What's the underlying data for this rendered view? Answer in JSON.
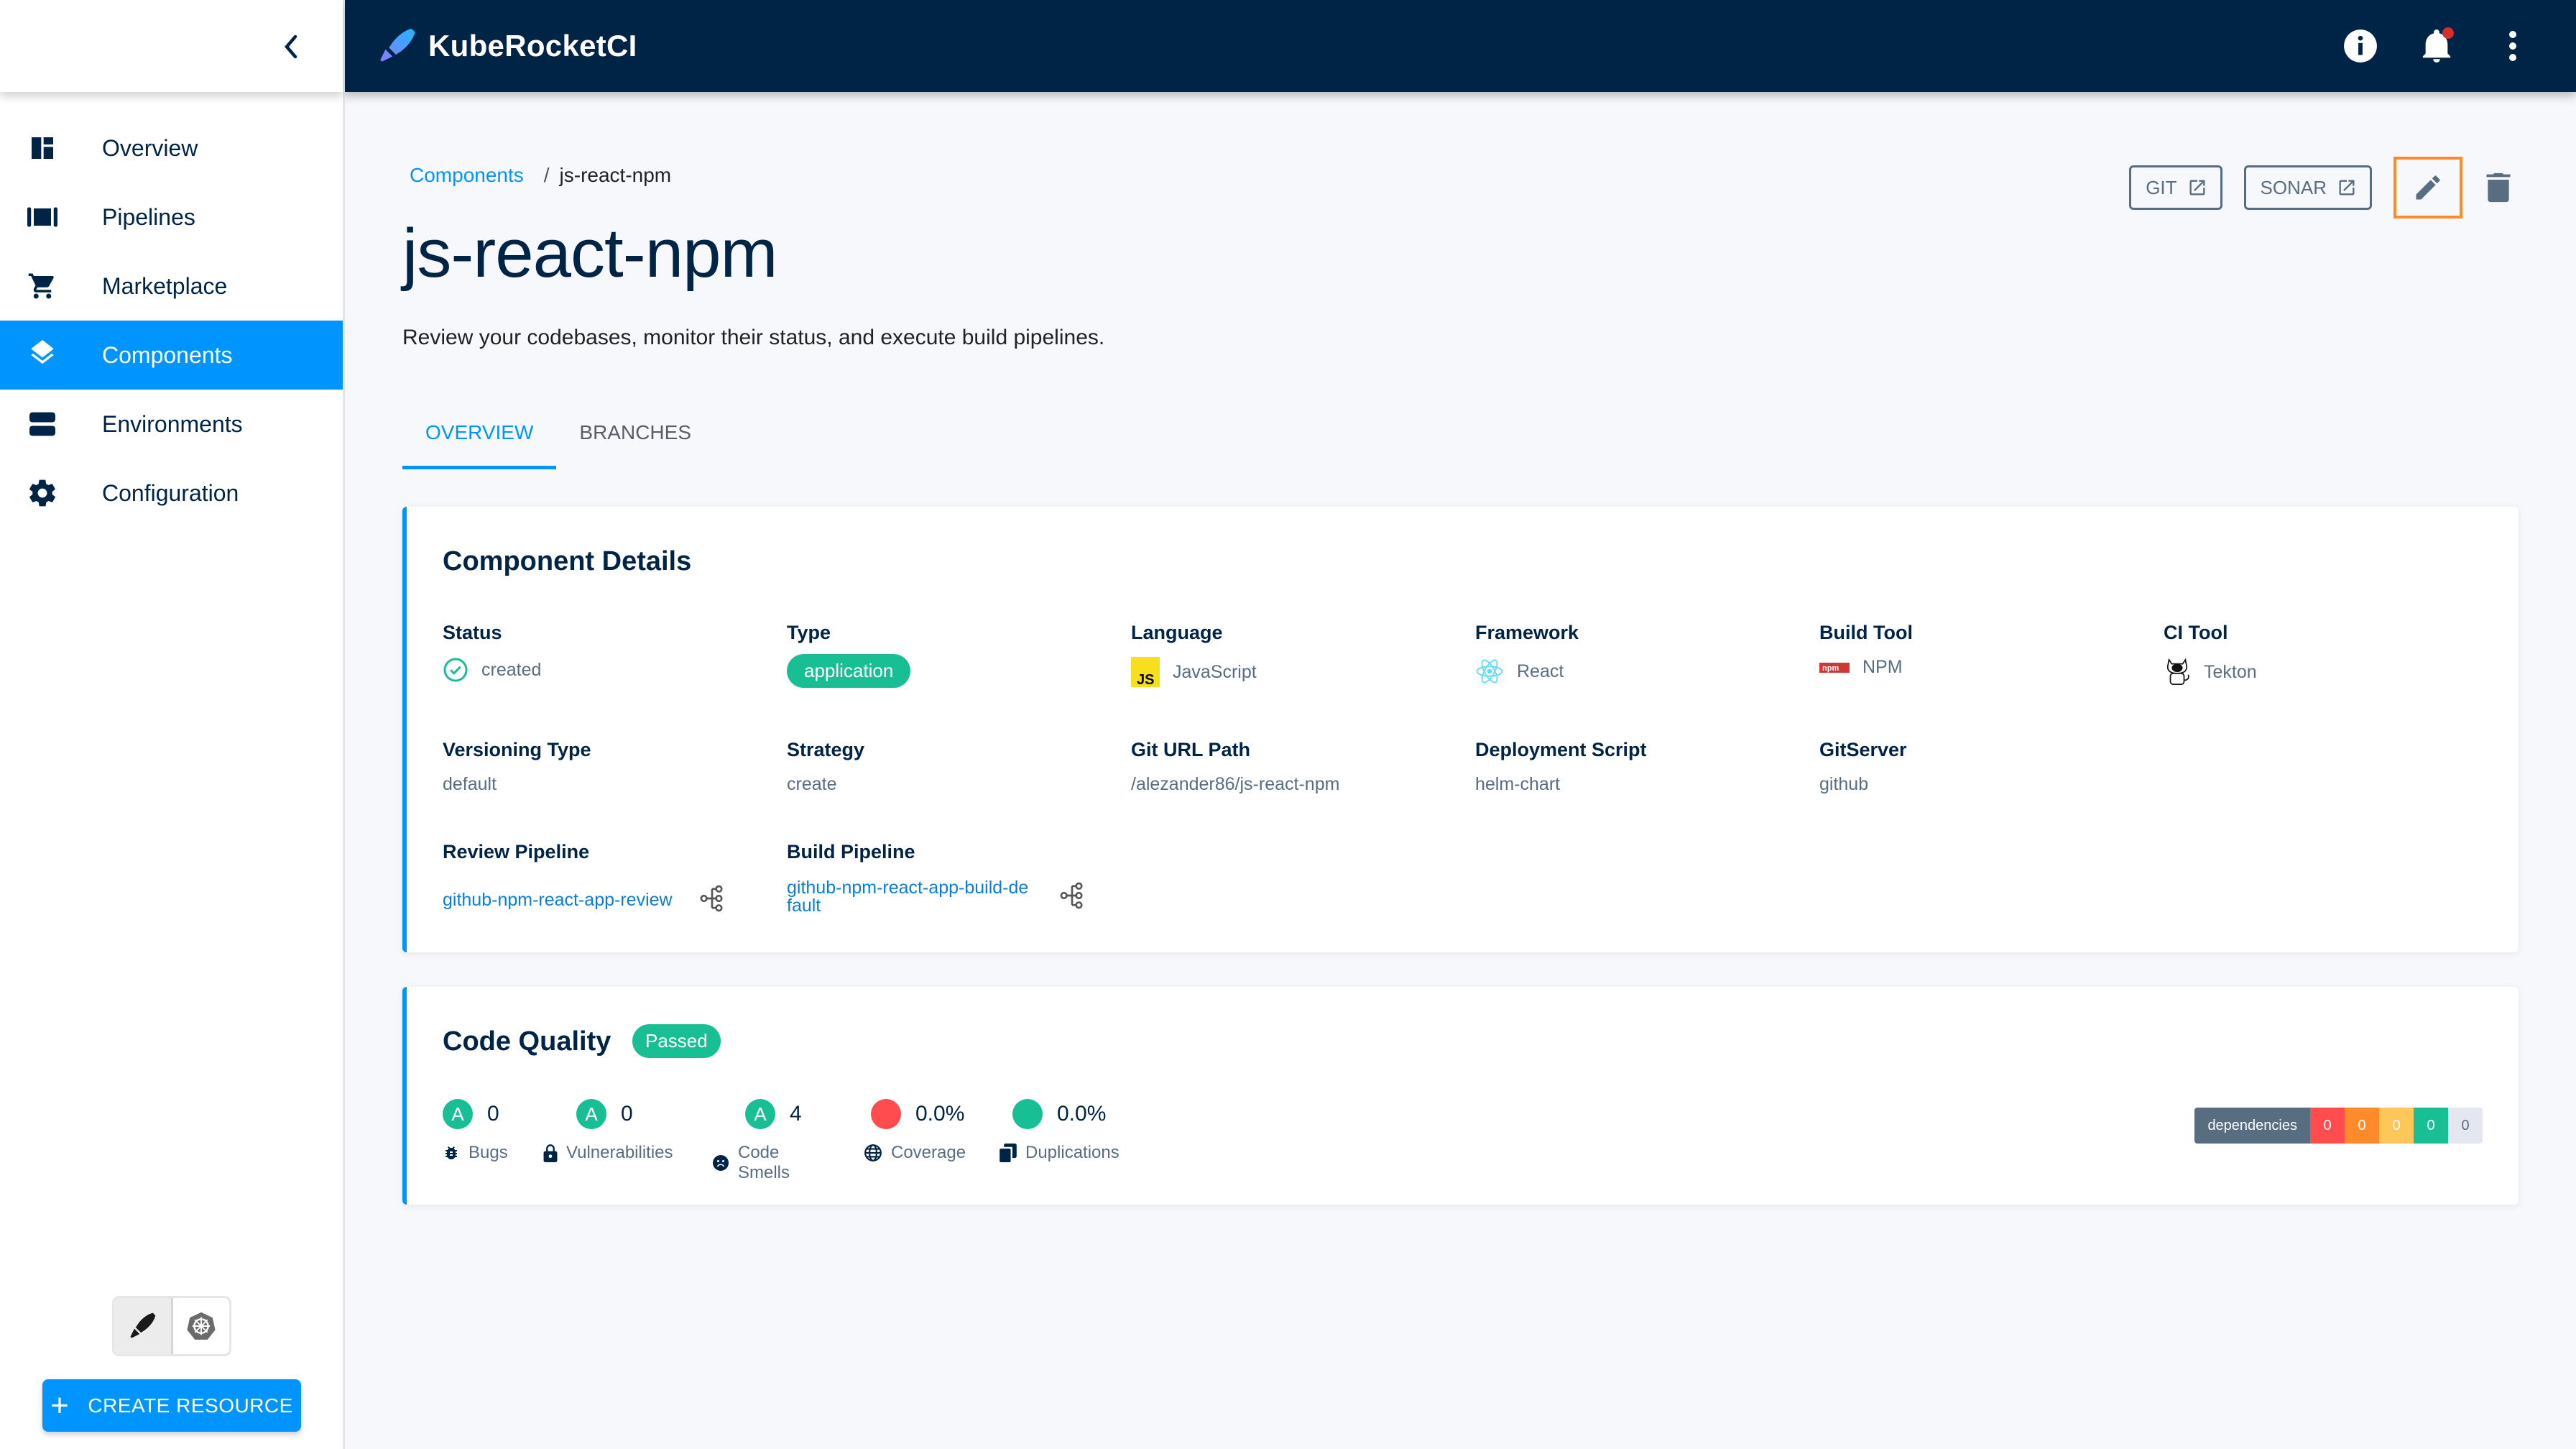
{
  "app": {
    "title": "KubeRocketCI",
    "notification_dot": true
  },
  "sidebar": {
    "items": [
      {
        "label": "Overview",
        "icon": "dashboard-icon",
        "active": false
      },
      {
        "label": "Pipelines",
        "icon": "pipelines-icon",
        "active": false
      },
      {
        "label": "Marketplace",
        "icon": "cart-icon",
        "active": false
      },
      {
        "label": "Components",
        "icon": "layers-icon",
        "active": true
      },
      {
        "label": "Environments",
        "icon": "environments-icon",
        "active": false
      },
      {
        "label": "Configuration",
        "icon": "gear-icon",
        "active": false
      }
    ],
    "create_button": "CREATE RESOURCE"
  },
  "breadcrumb": {
    "parent": "Components",
    "separator": "/",
    "current": "js-react-npm"
  },
  "page": {
    "title": "js-react-npm",
    "description": "Review your codebases, monitor their status, and execute build pipelines."
  },
  "header_actions": {
    "git_label": "GIT",
    "sonar_label": "SONAR"
  },
  "tabs": [
    {
      "label": "OVERVIEW",
      "active": true
    },
    {
      "label": "BRANCHES",
      "active": false
    }
  ],
  "details": {
    "title": "Component Details",
    "status": {
      "label": "Status",
      "value": "created"
    },
    "type": {
      "label": "Type",
      "value": "application"
    },
    "language": {
      "label": "Language",
      "value": "JavaScript"
    },
    "framework": {
      "label": "Framework",
      "value": "React"
    },
    "build_tool": {
      "label": "Build Tool",
      "value": "NPM"
    },
    "ci_tool": {
      "label": "CI Tool",
      "value": "Tekton"
    },
    "versioning_type": {
      "label": "Versioning Type",
      "value": "default"
    },
    "strategy": {
      "label": "Strategy",
      "value": "create"
    },
    "git_url_path": {
      "label": "Git URL Path",
      "value": "/alezander86/js-react-npm"
    },
    "deployment_script": {
      "label": "Deployment Script",
      "value": "helm-chart"
    },
    "git_server": {
      "label": "GitServer",
      "value": "github"
    },
    "review_pipeline": {
      "label": "Review Pipeline",
      "value": "github-npm-react-app-review"
    },
    "build_pipeline": {
      "label": "Build Pipeline",
      "value": "github-npm-react-app-build-default"
    }
  },
  "quality": {
    "title": "Code Quality",
    "gate": "Passed",
    "metrics": [
      {
        "name": "Bugs",
        "grade": "A",
        "value": "0"
      },
      {
        "name": "Vulnerabilities",
        "grade": "A",
        "value": "0"
      },
      {
        "name": "Code Smells",
        "grade": "A",
        "value": "4"
      },
      {
        "name": "Coverage",
        "value": "0.0%",
        "color": "#ff4d4f"
      },
      {
        "name": "Duplications",
        "value": "0.0%",
        "color": "#18be94"
      }
    ],
    "dependencies": {
      "label": "dependencies",
      "counts": [
        {
          "value": "0",
          "color": "#ff4d4f"
        },
        {
          "value": "0",
          "color": "#ff8a2a"
        },
        {
          "value": "0",
          "color": "#ffc658"
        },
        {
          "value": "0",
          "color": "#18be94"
        },
        {
          "value": "0",
          "color": "#e4e6f0"
        }
      ]
    }
  }
}
